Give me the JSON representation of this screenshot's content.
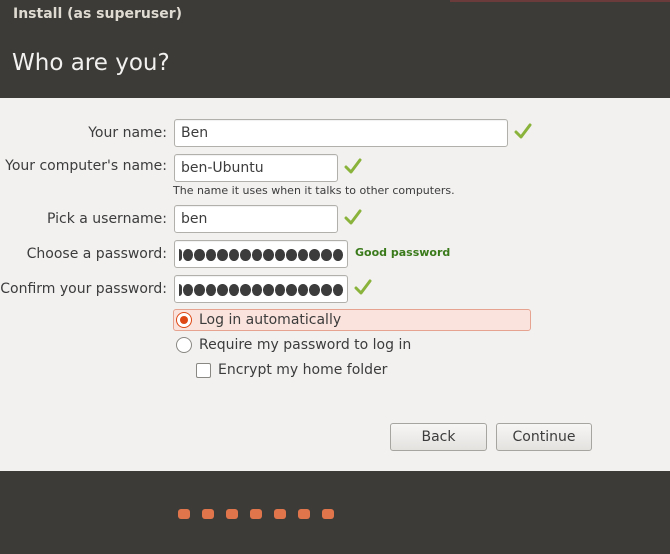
{
  "window": {
    "title": "Install (as superuser)"
  },
  "header": {
    "title": "Who are you?"
  },
  "form": {
    "name": {
      "label": "Your name:",
      "value": "Ben"
    },
    "computer": {
      "label": "Your computer's name:",
      "value": "ben-Ubuntu",
      "hint": "The name it uses when it talks to other computers."
    },
    "username": {
      "label": "Pick a username:",
      "value": "ben"
    },
    "password": {
      "label": "Choose a password:",
      "masked_length": 14,
      "strength": "Good password"
    },
    "confirm": {
      "label": "Confirm your password:",
      "masked_length": 14
    }
  },
  "login_options": {
    "auto": {
      "label": "Log in automatically",
      "selected": true
    },
    "require": {
      "label": "Require my password to log in",
      "selected": false
    },
    "encrypt": {
      "label": "Encrypt my home folder",
      "checked": false
    }
  },
  "buttons": {
    "back": "Back",
    "continue": "Continue"
  },
  "progress": {
    "total": 7
  },
  "colors": {
    "accent": "#dd4814",
    "check": "#8ab33c",
    "strength": "#3a7a1a",
    "dark": "#3c3b37"
  },
  "icons": {
    "valid": "check-icon"
  }
}
